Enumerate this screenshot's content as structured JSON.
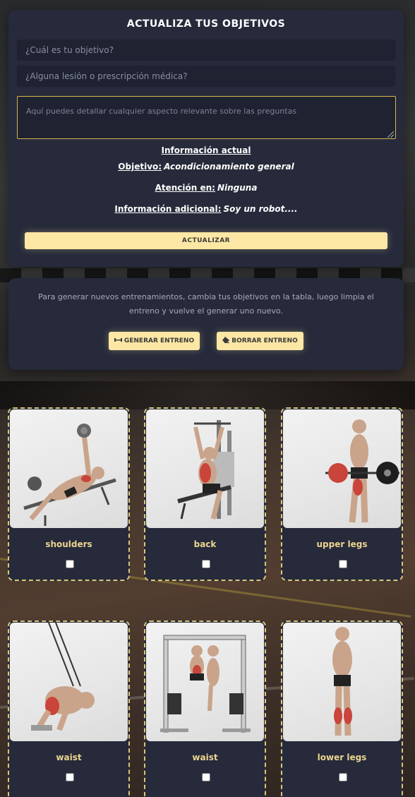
{
  "form": {
    "title": "ACTUALIZA TUS OBJETIVOS",
    "goal_placeholder": "¿Cuál es tu objetivo?",
    "injury_placeholder": "¿Alguna lesión o prescripción médica?",
    "details_placeholder": "Aquí puedes detallar cualquier aspecto relevante sobre las preguntas",
    "update_label": "ACTUALIZAR"
  },
  "current_info": {
    "heading": "Información actual",
    "goal_key": "Objetivo:",
    "goal_value": "Acondicionamiento general",
    "focus_key": "Atención en:",
    "focus_value": "Ninguna",
    "extra_key": "Información adicional:",
    "extra_value": "Soy un robot...."
  },
  "training": {
    "hint": "Para generar nuevos entrenamientos, cambia tus objetivos en la tabla, luego limpia el entreno y vuelve el generar uno nuevo.",
    "generate_label": "GENERAR ENTRENO",
    "generate_icon": "dumbbell-icon",
    "clear_label": "BORRAR ENTRENO",
    "clear_icon": "eraser-icon"
  },
  "body_parts": [
    {
      "label": "shoulders",
      "checked": false
    },
    {
      "label": "back",
      "checked": false
    },
    {
      "label": "upper legs",
      "checked": false
    },
    {
      "label": "waist",
      "checked": false
    },
    {
      "label": "waist",
      "checked": false
    },
    {
      "label": "lower legs",
      "checked": false
    }
  ],
  "colors": {
    "card_bg": "#262a3a",
    "accent_button": "#fde7a4",
    "label_gold": "#ecd491",
    "dashed_border": "#d9c67a",
    "muscle_highlight": "#c9443a"
  }
}
